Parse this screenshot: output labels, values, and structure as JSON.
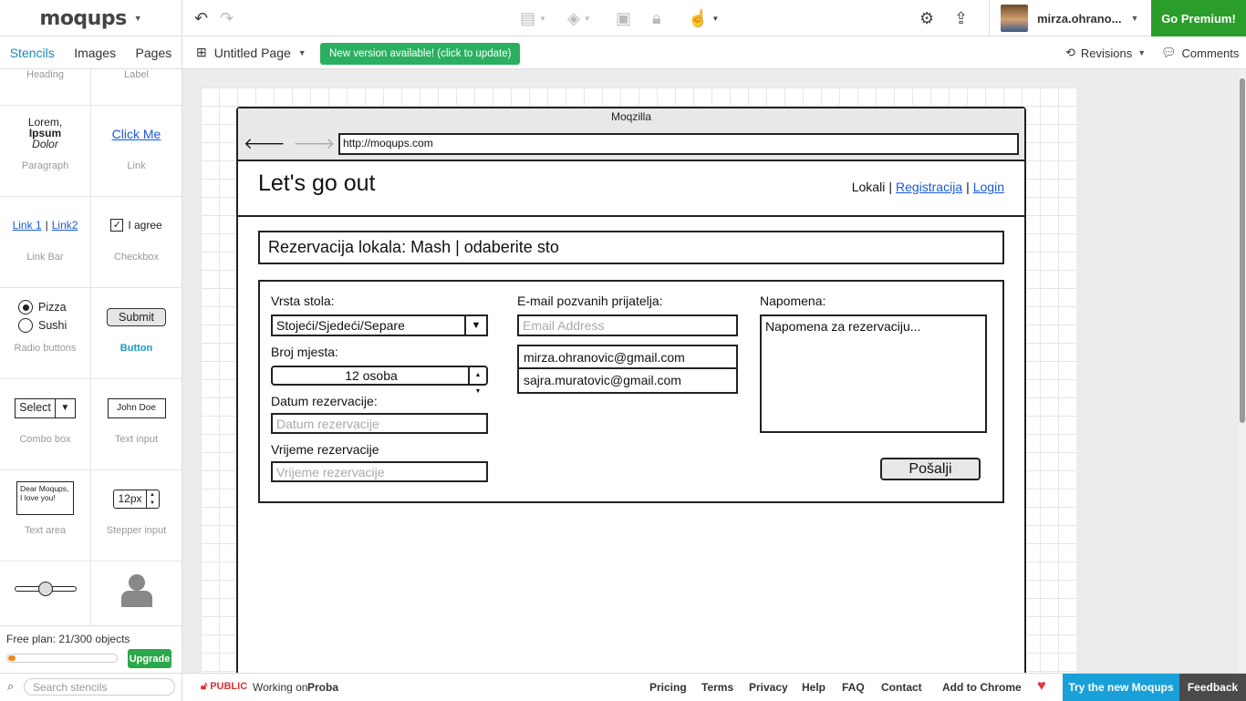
{
  "app": {
    "logo": "moqups",
    "user_name": "mirza.ohrano...",
    "premium_label": "Go Premium!",
    "tabs": [
      {
        "label": "Stencils",
        "active": true
      },
      {
        "label": "Images",
        "active": false
      },
      {
        "label": "Pages",
        "active": false
      }
    ],
    "page_name": "Untitled Page",
    "new_version": "New version available! (click to update)",
    "revisions_label": "Revisions",
    "comments_label": "Comments",
    "accent_color": "#1a8ab5",
    "premium_color": "#2a9d2a"
  },
  "stencils": [
    {
      "label": "Heading"
    },
    {
      "label": "Label"
    },
    {
      "label": "Paragraph",
      "preview": [
        "Lorem,",
        "Ipsum",
        "Dolor"
      ]
    },
    {
      "label": "Link",
      "preview": "Click Me"
    },
    {
      "label": "Link Bar",
      "preview": [
        "Link 1",
        "Link2"
      ]
    },
    {
      "label": "Checkbox",
      "preview": "I agree"
    },
    {
      "label": "Radio buttons",
      "preview": [
        "Pizza",
        "Sushi"
      ]
    },
    {
      "label": "Button",
      "preview": "Submit"
    },
    {
      "label": "Combo box",
      "preview": "Select"
    },
    {
      "label": "Text input",
      "preview": "John Doe"
    },
    {
      "label": "Text area",
      "preview": [
        "Dear Moqups,",
        "I love you!"
      ]
    },
    {
      "label": "Stepper input",
      "preview": "12px"
    }
  ],
  "plan": {
    "text": "Free plan: 21/300 objects",
    "used": 21,
    "limit": 300,
    "upgrade_label": "Upgrade"
  },
  "search": {
    "placeholder": "Search stencils"
  },
  "status": {
    "public_label": "PUBLIC",
    "working_on": "Working on",
    "project": "Proba",
    "links": [
      "Pricing",
      "Terms",
      "Privacy",
      "Help",
      "FAQ",
      "Contact"
    ],
    "add_chrome": "Add to Chrome",
    "try_new": "Try the new Moqups",
    "feedback": "Feedback"
  },
  "mockup": {
    "browser_title": "Moqzilla",
    "url": "http://moqups.com",
    "site_title": "Let's go out",
    "nav": {
      "current": "Lokali",
      "links": [
        "Registracija",
        "Login"
      ]
    },
    "banner": "Rezervacija lokala: Mash | odaberite sto",
    "form": {
      "table_type_label": "Vrsta stola:",
      "table_type_value": "Stojeći/Sjedeći/Separe",
      "seats_label": "Broj mjesta:",
      "seats_value": "12 osoba",
      "date_label": "Datum rezervacije:",
      "date_placeholder": "Datum rezervacije",
      "time_label": "Vrijeme rezervacije",
      "time_placeholder": "Vrijeme rezervacije",
      "email_label": "E-mail pozvanih prijatelja:",
      "email_placeholder": "Email Address",
      "emails": [
        "mirza.ohranovic@gmail.com",
        "sajra.muratovic@gmail.com"
      ],
      "note_label": "Napomena:",
      "note_value": "Napomena za rezervaciju...",
      "submit_label": "Pošalji"
    }
  }
}
